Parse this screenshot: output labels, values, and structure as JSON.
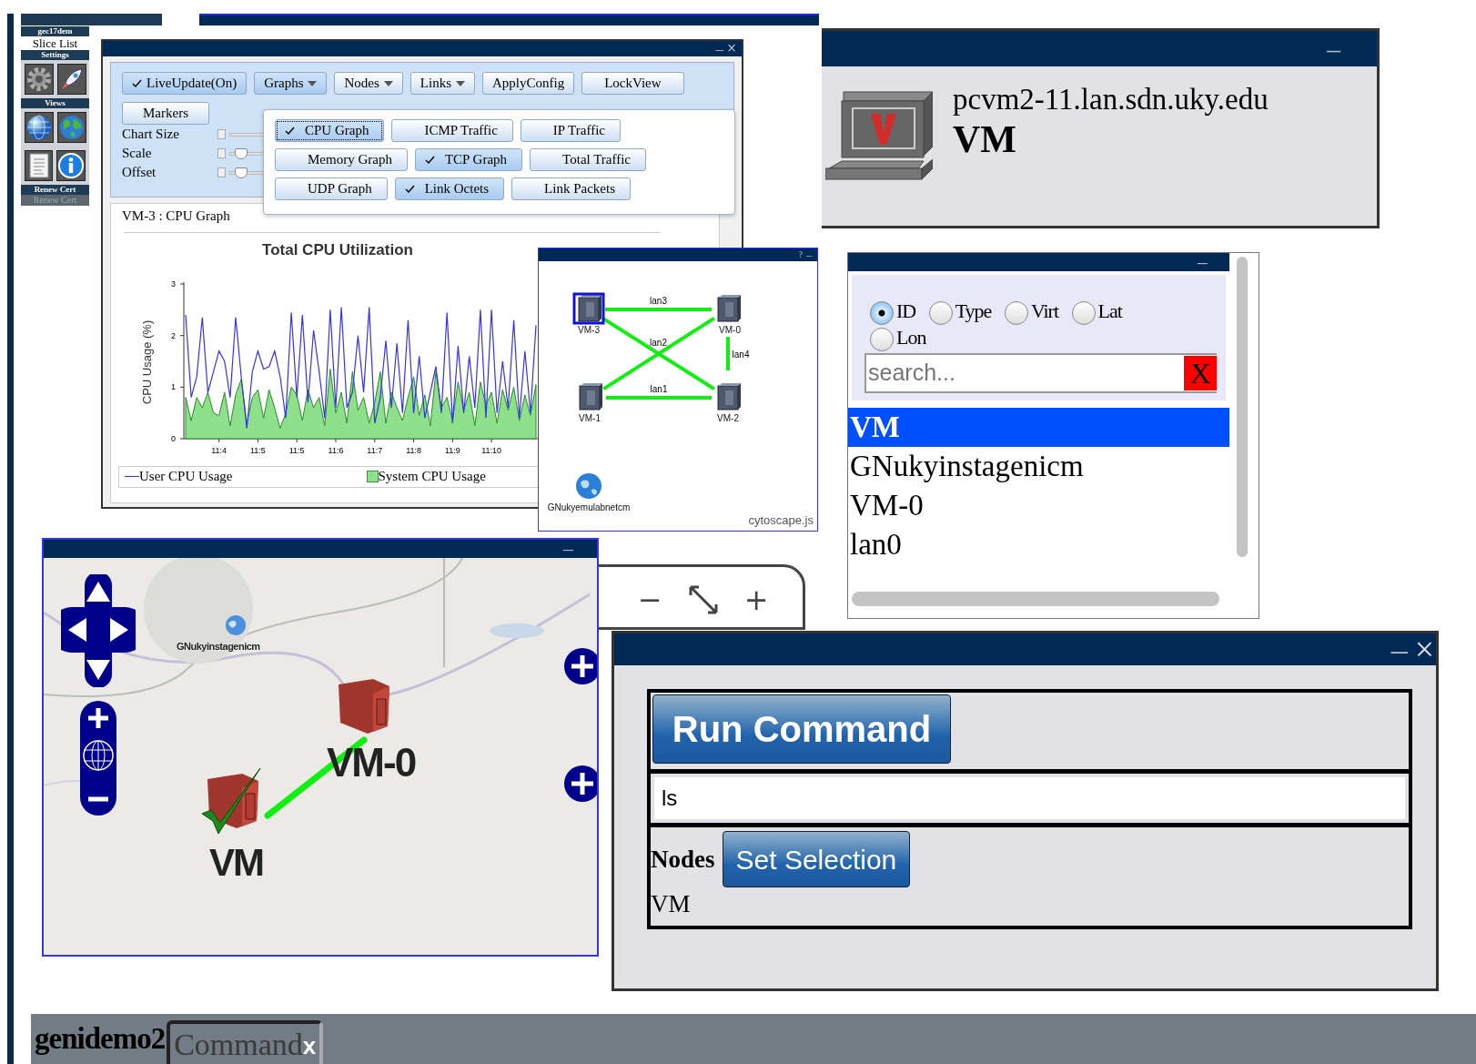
{
  "sidebar": {
    "user": "gec17dem",
    "slice_list": "Slice List",
    "settings_label": "Settings",
    "views_label": "Views",
    "renew_label": "Renew Cert",
    "renew_button": {
      "label": "Renew Cert",
      "disabled": true
    }
  },
  "graph_window": {
    "controls": [
      {
        "kind": "minimize",
        "label": "–"
      },
      {
        "kind": "close",
        "label": "×"
      }
    ],
    "toolbar": [
      {
        "label": "LiveUpdate(On)",
        "kind": "toggle",
        "checked": true
      },
      {
        "label": "Graphs",
        "kind": "dropdown",
        "expanded": true
      },
      {
        "label": "Nodes",
        "kind": "dropdown",
        "expanded": false
      },
      {
        "label": "Links",
        "kind": "dropdown",
        "expanded": false
      },
      {
        "label": "ApplyConfig",
        "kind": "button"
      },
      {
        "label": "LockView",
        "kind": "button"
      },
      {
        "label": "Markers",
        "kind": "button"
      }
    ],
    "sliders": [
      {
        "label": "Chart Size"
      },
      {
        "label": "Scale",
        "level": 0.05
      },
      {
        "label": "Offset",
        "level": 0.05
      }
    ],
    "graphs_menu": [
      {
        "label": "CPU Graph",
        "checked": true,
        "focused": true
      },
      {
        "label": "ICMP Traffic",
        "checked": false,
        "focused": false
      },
      {
        "label": "IP Traffic",
        "checked": false,
        "focused": false
      },
      {
        "label": "Memory Graph",
        "checked": false,
        "focused": false
      },
      {
        "label": "TCP Graph",
        "checked": true,
        "focused": false
      },
      {
        "label": "Total Traffic",
        "checked": false,
        "focused": false
      },
      {
        "label": "UDP Graph",
        "checked": false,
        "focused": false
      },
      {
        "label": "Link Octets",
        "checked": true,
        "focused": false
      },
      {
        "label": "Link Packets",
        "checked": false,
        "focused": false
      }
    ],
    "graph_title": "VM-3 : CPU Graph",
    "chart_data": {
      "type": "line",
      "title": "Total CPU Utilization",
      "ylabel": "CPU Usage (%)",
      "categories": [
        null,
        null,
        null,
        null,
        null,
        null,
        "11:4",
        null,
        null,
        null,
        null,
        null,
        null,
        "11:5",
        null,
        null,
        null,
        null,
        null,
        null,
        "11:5",
        null,
        null,
        null,
        null,
        null,
        null,
        "11:6",
        null,
        null,
        null,
        null,
        null,
        null,
        "11:7",
        null,
        null,
        null,
        null,
        null,
        null,
        "11:8",
        null,
        null,
        null,
        null,
        null,
        null,
        "11:9",
        null,
        null,
        null,
        null,
        null,
        null,
        "11:10",
        null,
        null,
        null,
        null,
        null,
        null,
        null,
        null
      ],
      "ylim": [
        0,
        3
      ],
      "yticks": [
        0,
        1,
        2,
        3
      ],
      "series": [
        {
          "name": "User CPU Usage",
          "color": "#3333ee",
          "values": [
            2.4,
            0.8,
            1.2,
            2.35,
            0.9,
            1.3,
            1.7,
            1.5,
            0.8,
            2.35,
            1.2,
            0.2,
            1.3,
            1.7,
            1.35,
            1.4,
            1.7,
            1.2,
            0.4,
            2.45,
            0.8,
            2.4,
            0.7,
            2.1,
            1.3,
            0.4,
            2.5,
            0.6,
            2.55,
            0.6,
            0.9,
            2.0,
            0.9,
            2.55,
            0.3,
            0.8,
            1.9,
            0.6,
            1.85,
            0.5,
            2.3,
            0.5,
            1.6,
            0.4,
            0.9,
            1.4,
            0.5,
            2.45,
            0.3,
            1.8,
            0.5,
            1.6,
            0.6,
            2.5,
            0.4,
            2.5,
            0.5,
            1.5,
            0.6,
            2.3,
            0.4,
            1.7,
            0.5,
            2.2
          ]
        },
        {
          "name": "System CPU Usage",
          "type": "area",
          "color": "#8ee08a",
          "values": [
            0.8,
            0.35,
            0.8,
            0.6,
            0.9,
            0.5,
            0.45,
            0.9,
            0.25,
            0.85,
            1.15,
            0.3,
            0.8,
            0.95,
            0.4,
            0.95,
            0.6,
            0.2,
            0.5,
            1.0,
            0.85,
            0.35,
            0.95,
            0.6,
            0.8,
            0.25,
            1.35,
            0.5,
            0.9,
            0.3,
            1.3,
            0.55,
            0.8,
            0.3,
            0.7,
            1.3,
            0.3,
            0.9,
            0.6,
            0.35,
            0.8,
            1.2,
            0.45,
            0.85,
            0.25,
            1.3,
            0.6,
            0.8,
            0.35,
            1.1,
            0.55,
            0.9,
            0.25,
            1.1,
            0.65,
            0.9,
            0.3,
            0.95,
            0.55,
            1.0,
            0.35,
            0.85,
            0.45,
            1.05
          ]
        }
      ]
    }
  },
  "topology_window": {
    "controls": [
      {
        "kind": "help",
        "label": "?"
      },
      {
        "kind": "minimize",
        "label": "–"
      }
    ],
    "nodes": [
      {
        "label": "VM-3",
        "kind": "server",
        "selected": true
      },
      {
        "label": "VM-0",
        "kind": "server",
        "selected": false
      },
      {
        "label": "VM-1",
        "kind": "server",
        "selected": false
      },
      {
        "label": "VM-2",
        "kind": "server",
        "selected": false
      },
      {
        "label": "GNukyemulabnetcm",
        "kind": "site",
        "selected": false
      }
    ],
    "links": [
      {
        "kind": "link",
        "label": "lan3"
      },
      {
        "kind": "link",
        "label": "lan2"
      },
      {
        "kind": "link"
      },
      {
        "kind": "link",
        "label": "lan4"
      },
      {
        "kind": "link",
        "label": "lan1"
      }
    ],
    "credit": "cytoscape.js"
  },
  "node_info": {
    "controls": [
      {
        "kind": "minimize",
        "label": "–"
      }
    ],
    "hostname": "pcvm2-11.lan.sdn.uky.edu",
    "name": "VM"
  },
  "search_panel": {
    "controls": [
      {
        "kind": "minimize",
        "label": "–"
      }
    ],
    "filters": [
      {
        "label": "ID",
        "selected": true
      },
      {
        "label": "Type",
        "selected": false
      },
      {
        "label": "Virt",
        "selected": false
      },
      {
        "label": "Lat",
        "selected": false
      },
      {
        "label": "Lon",
        "selected": false
      }
    ],
    "search": {
      "placeholder": "search..."
    },
    "clear_button": "X",
    "results": [
      {
        "label": "VM",
        "selected": true
      },
      {
        "label": "GNukyinstagenicm",
        "selected": false
      },
      {
        "label": "VM-0",
        "selected": false
      },
      {
        "label": "lan0",
        "selected": false
      }
    ]
  },
  "map_window": {
    "controls": [
      {
        "kind": "minimize",
        "label": "–"
      }
    ],
    "markers": [
      {
        "label": "VM-0",
        "kind": "vm",
        "checked": false
      },
      {
        "label": "VM",
        "kind": "vm",
        "checked": true
      },
      {
        "label": "GNukyinstagenicm",
        "kind": "site"
      }
    ]
  },
  "zoom_panel": {
    "buttons": [
      {
        "kind": "zoom_out",
        "label": "−"
      },
      {
        "kind": "fit"
      },
      {
        "kind": "zoom_in",
        "label": "+"
      }
    ]
  },
  "command_window": {
    "controls": [
      {
        "kind": "minimize",
        "label": "–"
      },
      {
        "kind": "close",
        "label": "×"
      }
    ],
    "run_button": "Run Command",
    "command": {
      "value": "ls"
    },
    "nodes_label": "Nodes",
    "set_button": "Set Selection",
    "selected_nodes": "VM"
  },
  "bottom_bar": {
    "slice": "genidemo2",
    "tabs": [
      {
        "label": "Command",
        "close": "x",
        "selected": true
      }
    ]
  }
}
